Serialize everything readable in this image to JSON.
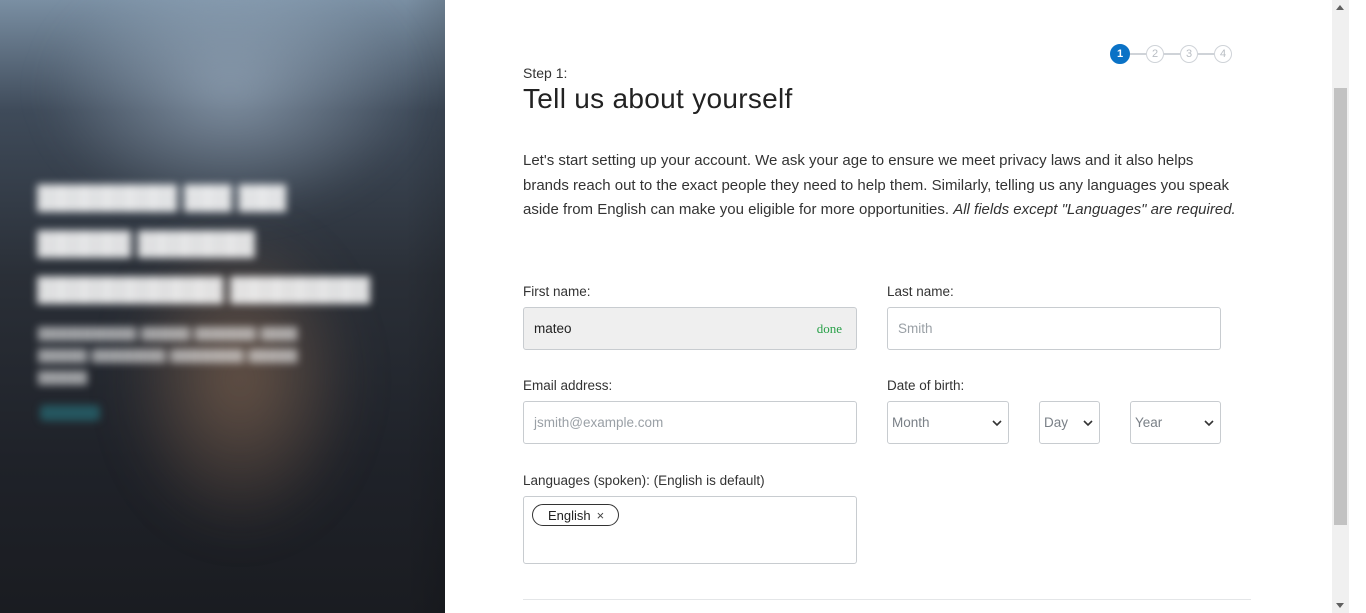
{
  "stepper": {
    "steps": [
      "1",
      "2",
      "3",
      "4"
    ],
    "active": 1
  },
  "header": {
    "step_label": "Step 1:",
    "title": "Tell us about yourself"
  },
  "intro": {
    "text": "Let's start setting up your account. We ask your age to ensure we meet privacy laws and it also helps brands reach out to the exact people they need to help them. Similarly, telling us any languages you speak aside from English can make you eligible for more opportunities. ",
    "emphasis": "All fields except \"Languages\" are required."
  },
  "form": {
    "first_name": {
      "label": "First name:",
      "value": "mateo",
      "status": "done"
    },
    "last_name": {
      "label": "Last name:",
      "placeholder": "Smith"
    },
    "email": {
      "label": "Email address:",
      "placeholder": "jsmith@example.com"
    },
    "dob": {
      "label": "Date of birth:",
      "month": "Month",
      "day": "Day",
      "year": "Year"
    },
    "languages": {
      "label": "Languages (spoken):",
      "hint": "(English is default)",
      "chips": [
        {
          "label": "English",
          "remove": "×"
        }
      ]
    }
  },
  "colors": {
    "accent": "#0a72c6",
    "success": "#2aa14a",
    "hero_dark": "#1f2229"
  }
}
